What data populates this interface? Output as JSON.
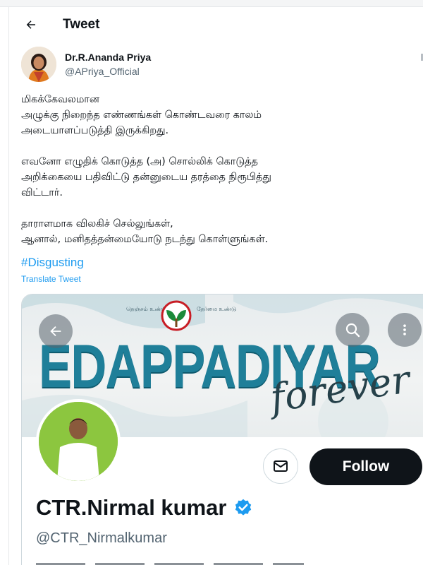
{
  "header": {
    "title": "Tweet",
    "back_icon": "arrow-left-icon"
  },
  "author": {
    "name": "Dr.R.Ananda Priya",
    "handle": "@APriya_Official"
  },
  "tweet": {
    "lines": [
      "மிகக்கேவலமான",
      "அழுக்கு நிறைந்த எண்ணங்கள் கொண்டவரை காலம்",
      "அடையாளப்படுத்தி இருக்கிறது.",
      "",
      "எவனோ எழுதிக் கொடுத்த (அ) சொல்லிக் கொடுத்த",
      "அறிக்கையை பதிவிட்டு தன்னுடைய தரத்தை நிரூபித்து",
      "விட்டார்.",
      "",
      "தாராளமாக விலகிச் செல்லுங்கள்,",
      "ஆனால், மனிதத்தன்மையோடு நடந்து கொள்ளுங்கள்."
    ],
    "hashtag": "#Disgusting",
    "translate_label": "Translate Tweet"
  },
  "card": {
    "banner_word": "EDAPPADIYAR",
    "banner_script": "forever",
    "banner_tag_left": "நெஞ்சம் உண்டு",
    "banner_tag_right": "நேர்மை உண்டு",
    "profile_name": "CTR.Nirmal kumar",
    "profile_handle": "@CTR_Nirmalkumar",
    "follow_label": "Follow",
    "icons": [
      "arrow-left-icon",
      "search-icon",
      "more-vertical-icon",
      "mail-icon",
      "verified-badge-icon"
    ]
  },
  "colors": {
    "accent": "#1d9bf0",
    "text": "#0f1419",
    "muted": "#536471",
    "follow_bg": "#0f1419",
    "banner_text": "#1f7f99"
  }
}
